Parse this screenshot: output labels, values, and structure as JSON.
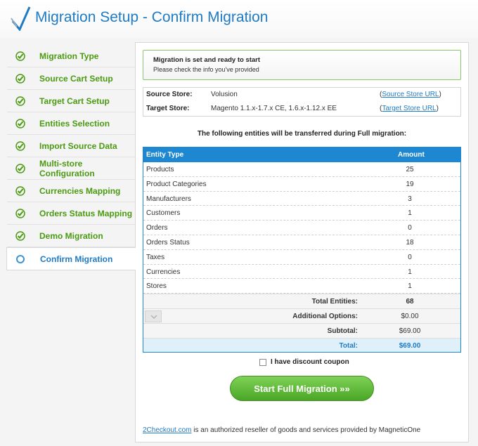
{
  "header": {
    "title": "Migration Setup - Confirm Migration"
  },
  "sidebar": {
    "steps": [
      {
        "label": "Migration Type"
      },
      {
        "label": "Source Cart Setup"
      },
      {
        "label": "Target Cart Setup"
      },
      {
        "label": "Entities Selection"
      },
      {
        "label": "Import Source Data"
      },
      {
        "label": "Multi-store Configuration"
      },
      {
        "label": "Currencies Mapping"
      },
      {
        "label": "Orders Status Mapping"
      },
      {
        "label": "Demo Migration"
      },
      {
        "label": "Confirm Migration"
      }
    ]
  },
  "notice": {
    "title": "Migration is set and ready to start",
    "subtitle": "Please check the info you've provided"
  },
  "stores": {
    "source_label": "Source Store:",
    "source_value": "Volusion",
    "source_link": "Source Store URL",
    "target_label": "Target Store:",
    "target_value": "Magento 1.1.x-1.7.x CE, 1.6.x-1.12.x EE",
    "target_link": "Target Store URL"
  },
  "entities": {
    "caption": "The following entities will be transferred during Full migration:",
    "col_type": "Entity Type",
    "col_amount": "Amount",
    "rows": [
      {
        "type": "Products",
        "amount": "25"
      },
      {
        "type": "Product Categories",
        "amount": "19"
      },
      {
        "type": "Manufacturers",
        "amount": "3"
      },
      {
        "type": "Customers",
        "amount": "1"
      },
      {
        "type": "Orders",
        "amount": "0"
      },
      {
        "type": "Orders Status",
        "amount": "18"
      },
      {
        "type": "Taxes",
        "amount": "0"
      },
      {
        "type": "Currencies",
        "amount": "1"
      },
      {
        "type": "Stores",
        "amount": "1"
      }
    ],
    "total_entities_label": "Total Entities:",
    "total_entities_value": "68",
    "additional_options_label": "Additional Options:",
    "additional_options_value": "$0.00",
    "subtotal_label": "Subtotal:",
    "subtotal_value": "$69.00",
    "total_label": "Total:",
    "total_value": "$69.00"
  },
  "coupon": {
    "label": "I have discount coupon"
  },
  "start_button": {
    "label": "Start Full Migration »»"
  },
  "footer": {
    "link": "2Checkout.com",
    "text": " is an authorized reseller of goods and services provided by MagneticOne"
  },
  "colors": {
    "accent_blue": "#1f7bc4",
    "step_green": "#4b9a12",
    "table_header": "#1d87d2",
    "button_green": "#5cb833"
  }
}
